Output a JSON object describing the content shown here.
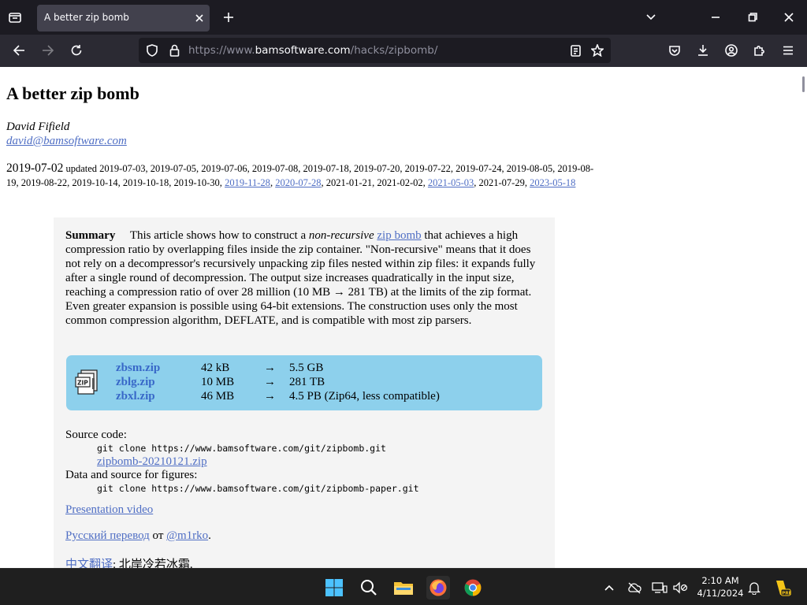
{
  "browser": {
    "tab_title": "A better zip bomb",
    "url_prefix": "https://www.",
    "url_host": "bamsoftware.com",
    "url_path": "/hacks/zipbomb/"
  },
  "page": {
    "title": "A better zip bomb",
    "author": "David Fifield",
    "email": "david@bamsoftware.com",
    "date_main": "2019-07-02",
    "updated_label": "updated",
    "dates_plain_1": "2019-07-03, 2019-07-05, 2019-07-06, 2019-07-08, 2019-07-18, 2019-07-20, 2019-07-22, 2019-07-24, 2019-08-05, 2019-08-19, 2019-08-22, 2019-10-14, 2019-10-18, 2019-10-30,",
    "date_link_1": "2019-11-28",
    "date_link_2": "2020-07-28",
    "dates_plain_2": ", 2021-01-21, 2021-02-02,",
    "date_link_3": "2021-05-03",
    "dates_plain_3": ", 2021-07-29,",
    "date_link_4": "2023-05-18",
    "summary_label": "Summary",
    "summary_p1": "This article shows how to construct a",
    "summary_em": "non-recursive",
    "summary_link": "zip bomb",
    "summary_p2": "that achieves a high compression ratio by overlapping files inside the zip container. \"Non-recursive\" means that it does not rely on a decompressor's recursively unpacking zip files nested within zip files: it expands fully after a single round of decompression. The output size increases quadratically in the input size, reaching a compression ratio of over 28 million (10 MB → 281 TB) at the limits of the zip format. Even greater expansion is possible using 64-bit extensions. The construction uses only the most common compression algorithm, DEFLATE, and is compatible with most zip parsers.",
    "downloads": [
      {
        "name": "zbsm.zip",
        "size": "42 kB",
        "arrow": "→",
        "out": "5.5 GB"
      },
      {
        "name": "zblg.zip",
        "size": "10 MB",
        "arrow": "→",
        "out": "281 TB"
      },
      {
        "name": "zbxl.zip",
        "size": "46 MB",
        "arrow": "→",
        "out": "4.5 PB (Zip64, less compatible)"
      }
    ],
    "source_label": "Source code:",
    "source_cmd": "git clone https://www.bamsoftware.com/git/zipbomb.git",
    "source_zip": "zipbomb-20210121.zip",
    "figures_label": "Data and source for figures:",
    "figures_cmd": "git clone https://www.bamsoftware.com/git/zipbomb-paper.git",
    "video_link": "Presentation video",
    "russian_link": "Русский перевод",
    "russian_from": "от",
    "russian_author": "@m1rko",
    "chinese_link": "中文翻译",
    "chinese_rest": ": 北岸冷若冰霜."
  },
  "taskbar": {
    "time": "2:10 AM",
    "date": "4/11/2024"
  },
  "colors": {
    "link": "#4f6ec4",
    "download_bg": "#8dd0ec",
    "summary_bg": "#f4f4f4"
  }
}
